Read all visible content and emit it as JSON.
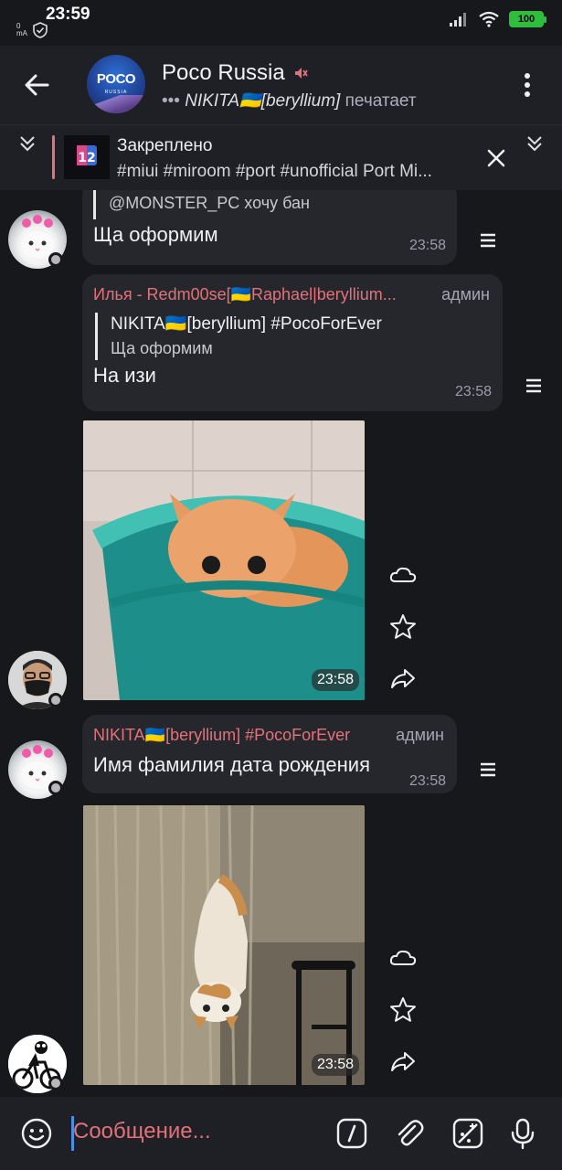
{
  "status_bar": {
    "time": "23:59",
    "battery": "100",
    "left_small": "0 mA"
  },
  "header": {
    "title": "Poco Russia",
    "typing_dots": "•••",
    "typing_name": "NIKITA🇺🇦[beryllium]",
    "typing_action": "печатает",
    "avatar_logo": "POCO",
    "avatar_sub": "RUSSIA"
  },
  "pinned": {
    "title": "Закреплено",
    "text": "#miui #miroom #port #unofficial  Port Mi..."
  },
  "messages": [
    {
      "quote_text": "@MONSTER_PC хочу бан",
      "text": "Ща оформим",
      "time": "23:58"
    },
    {
      "sender": "Илья - Redm00se[🇺🇦Raphael|beryllium...",
      "badge": "админ",
      "quote_author": "NIKITA🇺🇦[beryllium] #PocoForEver",
      "quote_text": "Ща оформим",
      "text": "На изи",
      "time": "23:58"
    },
    {
      "photo_time": "23:58"
    },
    {
      "sender": "NIKITA🇺🇦[beryllium] #PocoForEver",
      "badge": "админ",
      "text": "Имя фамилия дата рождения",
      "time": "23:58"
    },
    {
      "photo_time": "23:58"
    }
  ],
  "input": {
    "placeholder": "Сообщение..."
  },
  "colors": {
    "accent": "#e2717a",
    "bubble": "#26272c",
    "background": "#17181c",
    "header": "#1f2025"
  }
}
